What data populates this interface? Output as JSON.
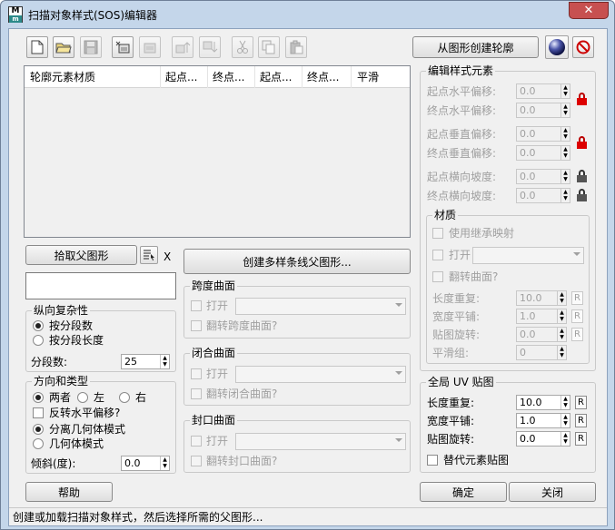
{
  "window": {
    "title": "扫描对象样式(SOS)编辑器",
    "close_glyph": "✕"
  },
  "toolbar": {
    "create_from_shape": "从图形创建轮廓"
  },
  "list": {
    "columns": [
      "轮廓元素材质",
      "起点...",
      "终点...",
      "起点...",
      "终点...",
      "平滑"
    ]
  },
  "pick": {
    "label": "拾取父图形",
    "x_label": "X",
    "name_value": ""
  },
  "multispline": {
    "label": "创建多样条线父图形..."
  },
  "length_complexity": {
    "title": "纵向复杂性",
    "by_segments": "按分段数",
    "by_segment_length": "按分段长度",
    "segments_label": "分段数:",
    "segments_value": "25"
  },
  "direction": {
    "title": "方向和类型",
    "both": "两者",
    "left": "左",
    "right": "右",
    "reverse_h": "反转水平偏移?",
    "split_mode": "分离几何体模式",
    "geom_mode": "几何体模式",
    "tilt_label": "倾斜(度):",
    "tilt_value": "0.0"
  },
  "span_surface": {
    "title": "跨度曲面",
    "open": "打开",
    "flip": "翻转跨度曲面?"
  },
  "closed_surface": {
    "title": "闭合曲面",
    "open": "打开",
    "flip": "翻转闭合曲面?"
  },
  "cap_surface": {
    "title": "封口曲面",
    "open": "打开",
    "flip": "翻转封口曲面?"
  },
  "edit_style": {
    "title": "编辑样式元素",
    "start_h": "起点水平偏移:",
    "end_h": "终点水平偏移:",
    "start_v": "起点垂直偏移:",
    "end_v": "终点垂直偏移:",
    "start_slope": "起点横向坡度:",
    "end_slope": "终点横向坡度:",
    "zero": "0.0"
  },
  "material": {
    "title": "材质",
    "inherit": "使用继承映射",
    "open": "打开",
    "flip": "翻转曲面?",
    "length_repeat": "长度重复:",
    "width_tile": "宽度平铺:",
    "map_rotate": "贴图旋转:",
    "smooth_group": "平滑组:",
    "v_len": "10.0",
    "v_wid": "1.0",
    "v_rot": "0.0",
    "v_smooth": "0",
    "r": "R"
  },
  "global_uv": {
    "title": "全局 UV 贴图",
    "length_repeat": "长度重复:",
    "width_tile": "宽度平铺:",
    "map_rotate": "贴图旋转:",
    "v_len": "10.0",
    "v_wid": "1.0",
    "v_rot": "0.0",
    "r": "R",
    "override": "替代元素贴图"
  },
  "buttons": {
    "help": "帮助",
    "ok": "确定",
    "close": "关闭"
  },
  "status": "创建或加载扫描对象样式，然后选择所需的父图形..."
}
